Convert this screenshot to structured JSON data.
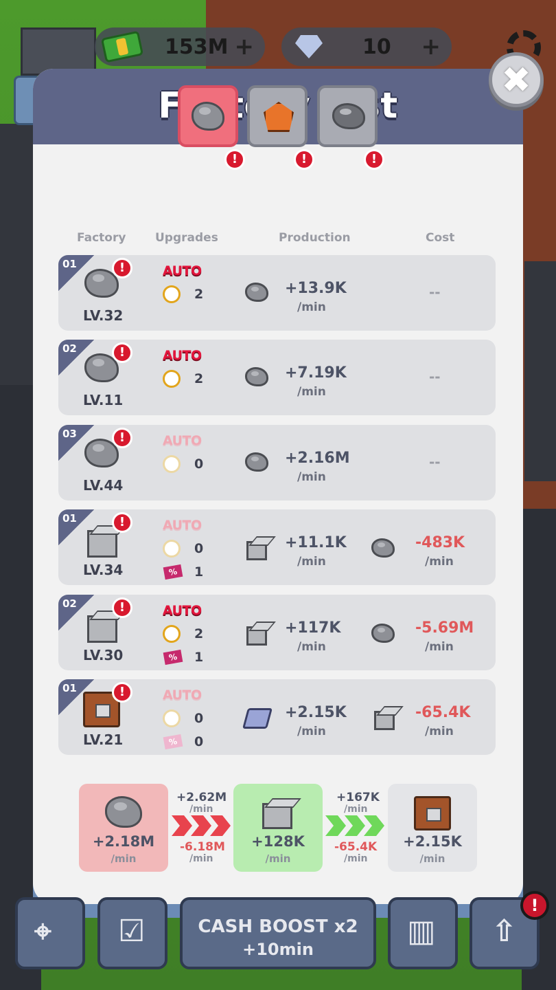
{
  "hud": {
    "cash": "153M",
    "gems": "10",
    "plus": "+"
  },
  "modal": {
    "title": "Factory List",
    "close": "✖",
    "badge": "!",
    "headers": {
      "factory": "Factory",
      "upgrades": "Upgrades",
      "production": "Production",
      "cost": "Cost"
    },
    "auto_label": "AUTO",
    "per_min": "/min",
    "pct": "%",
    "rows": [
      {
        "num": "01",
        "icon": "stone",
        "level": "LV.32",
        "auto_active": true,
        "speed": "2",
        "discount": null,
        "production": "+13.9K",
        "prod_icon": "stone",
        "cost": "--",
        "cost_icon": null
      },
      {
        "num": "02",
        "icon": "stone",
        "level": "LV.11",
        "auto_active": true,
        "speed": "2",
        "discount": null,
        "production": "+7.19K",
        "prod_icon": "stone",
        "cost": "--",
        "cost_icon": null
      },
      {
        "num": "03",
        "icon": "stone",
        "level": "LV.44",
        "auto_active": false,
        "speed": "0",
        "discount": null,
        "production": "+2.16M",
        "prod_icon": "stone",
        "cost": "--",
        "cost_icon": null
      },
      {
        "num": "01",
        "icon": "cube",
        "level": "LV.34",
        "auto_active": false,
        "speed": "0",
        "discount": "1",
        "production": "+11.1K",
        "prod_icon": "cube",
        "cost": "-483K",
        "cost_icon": "stone"
      },
      {
        "num": "02",
        "icon": "cube",
        "level": "LV.30",
        "auto_active": true,
        "speed": "2",
        "discount": "1",
        "production": "+117K",
        "prod_icon": "cube",
        "cost": "-5.69M",
        "cost_icon": "stone"
      },
      {
        "num": "01",
        "icon": "crate",
        "level": "LV.21",
        "auto_active": false,
        "speed": "0",
        "discount": "0",
        "production": "+2.15K",
        "prod_icon": "slab",
        "cost": "-65.4K",
        "cost_icon": "cube"
      }
    ],
    "summary": {
      "stone": {
        "value": "+2.18M",
        "color": "#f2b8b9"
      },
      "flow1": {
        "in": "+2.62M",
        "out": "-6.18M",
        "color": "#e8434d"
      },
      "cube": {
        "value": "+128K",
        "color": "#b8ecb0"
      },
      "flow2": {
        "in": "+167K",
        "out": "-65.4K",
        "color": "#6fd85a"
      },
      "crate": {
        "value": "+2.15K",
        "color": "#e4e5e8"
      }
    }
  },
  "bottom_nav": {
    "boost_line1": "CASH BOOST x2",
    "boost_line2": "+10min",
    "badge": "!"
  }
}
